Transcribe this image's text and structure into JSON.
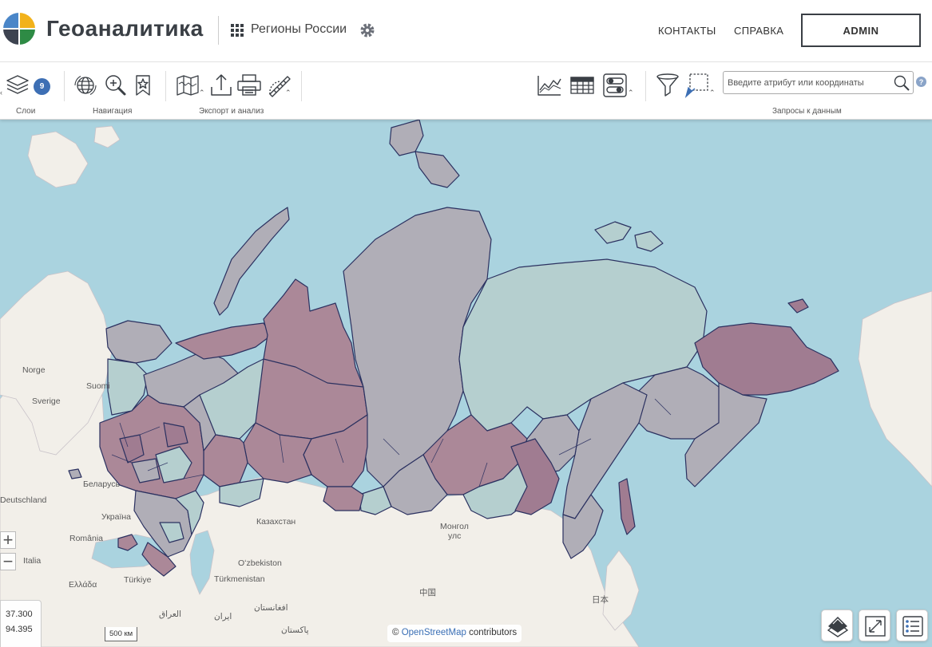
{
  "header": {
    "app_title": "Геоаналитика",
    "project_name": "Регионы России",
    "nav": {
      "contacts": "КОНТАКТЫ",
      "help": "СПРАВКА"
    },
    "user_button": "ADMIN"
  },
  "toolbar": {
    "layers_badge": "9",
    "groups": {
      "layers": "Слои",
      "navigation": "Навигация",
      "export": "Экспорт и анализ",
      "queries": "Запросы к данным"
    },
    "search": {
      "placeholder": "Введите атрибут или координаты",
      "value": ""
    },
    "help_glyph": "?"
  },
  "map": {
    "labels": {
      "norge": "Norge",
      "sverige": "Sverige",
      "suomi": "Suomi",
      "belarus": "Беларусь",
      "deutschland": "Deutschland",
      "ukraine": "Україна",
      "romania": "România",
      "italia": "Italia",
      "ellada": "Ελλάδα",
      "turkiye": "Türkiye",
      "kazakhstan": "Казахстан",
      "uzbekistan": "Oʻzbekiston",
      "turkmenistan": "Türkmenistan",
      "mongolia_1": "Монгол",
      "mongolia_2": "улс",
      "china": "中国",
      "japan": "日本",
      "iraq": "العراق",
      "iran": "ایران",
      "afghanistan": "افغانستان",
      "pakistan": "پاکستان"
    },
    "coords": {
      "lon": "37.300",
      "lat": "94.395"
    },
    "scale": "500 км",
    "attribution": {
      "prefix": "©",
      "link": "OpenStreetMap",
      "suffix": "contributors"
    },
    "colors": {
      "sea": "#aad3df",
      "land": "#f2efe9",
      "region_gray": "#b0aeb7",
      "region_mauve": "#ab8898",
      "region_teal": "#b5cfcf",
      "region_pink": "#a07c91",
      "border": "#2b3160"
    }
  }
}
